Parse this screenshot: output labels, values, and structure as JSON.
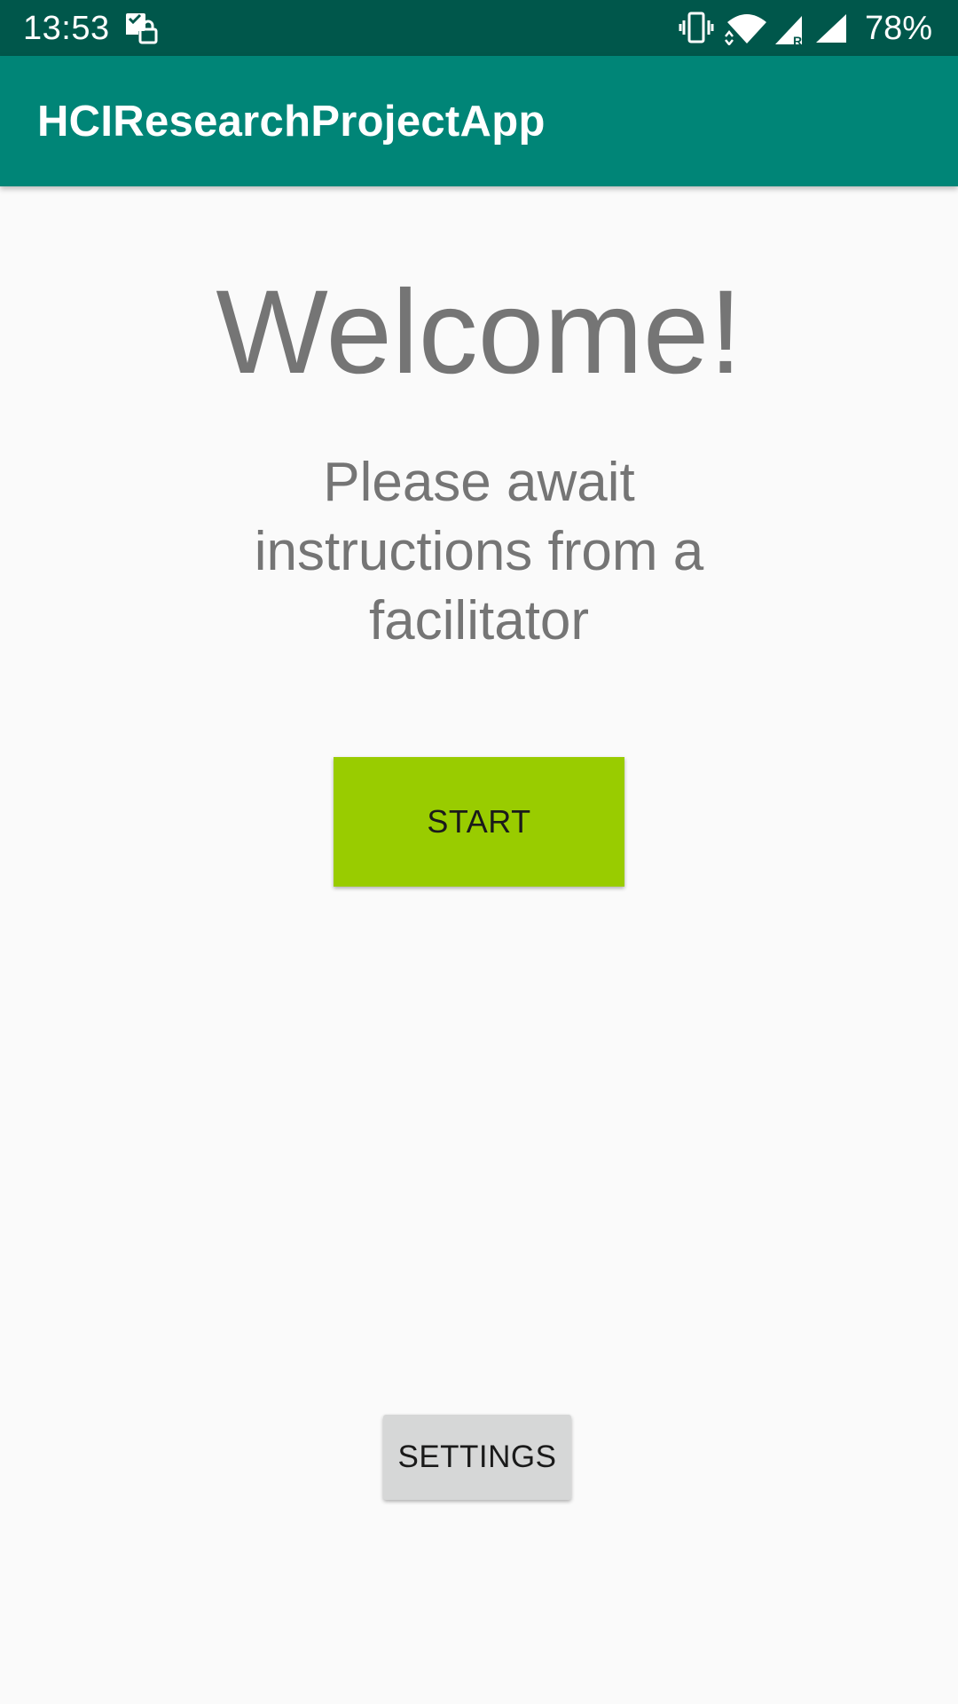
{
  "status_bar": {
    "time": "13:53",
    "battery": "78%",
    "icons": [
      "notification-icon",
      "vibrate-icon",
      "wifi-icon",
      "signal-roaming-icon",
      "signal-icon"
    ]
  },
  "app_bar": {
    "title": "HCIResearchProjectApp"
  },
  "main": {
    "welcome": "Welcome!",
    "instructions": "Please await instructions from a facilitator",
    "start_label": "START",
    "settings_label": "SETTINGS"
  },
  "colors": {
    "status_bar": "#00574b",
    "app_bar": "#008577",
    "start_button": "#99cc00",
    "settings_button": "#d6d7d7",
    "text_gray": "#757575"
  }
}
